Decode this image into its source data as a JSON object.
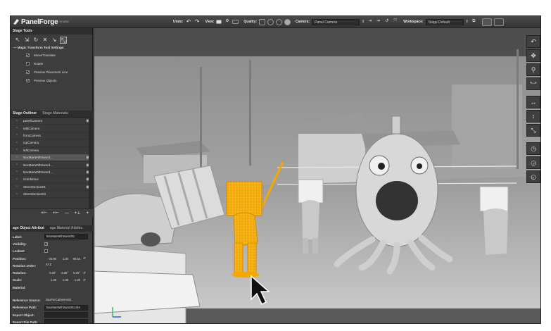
{
  "app": {
    "name": "PanelForge",
    "sup": "STUDIO"
  },
  "toolbar": {
    "undo_label": "Undo:",
    "undo_icon": "↶",
    "redo_icon": "↷",
    "view_label": "View:",
    "quality_label": "Quality:",
    "camera_label": "Camera:",
    "camera_value": "Panel Camera",
    "camera_spin": "⇕",
    "workspace_label": "Workspace:",
    "workspace_value": "Stage Default",
    "workspace_spin": "⇕"
  },
  "stage_tools": {
    "title": "Stage Tools",
    "magic_title": "Magic Transform Tool Settings:",
    "options": [
      {
        "label": "Move/Translate",
        "checked": true
      },
      {
        "label": "Rotate",
        "checked": false
      },
      {
        "label": "Preview Placement Line",
        "checked": true
      },
      {
        "label": "Preview Objects",
        "checked": true
      }
    ]
  },
  "outliner": {
    "tab_active": "Stage Outliner",
    "tab_inactive": "Stage Materials",
    "items": [
      {
        "name": "panelCamera",
        "highlight": false,
        "vis": "◉"
      },
      {
        "name": "editCamera",
        "highlight": false,
        "vis": ""
      },
      {
        "name": "frontCamera",
        "highlight": false,
        "vis": ""
      },
      {
        "name": "topCamera",
        "highlight": false,
        "vis": ""
      },
      {
        "name": "leftCamera",
        "highlight": false,
        "vis": ""
      },
      {
        "name": "BoxManWithSword...",
        "highlight": true,
        "vis": "◉"
      },
      {
        "name": "BoxManWithSword...",
        "highlight": false,
        "vis": "◉"
      },
      {
        "name": "BoxManWithSword...",
        "highlight": false,
        "vis": "◉"
      },
      {
        "name": "Grimbletus",
        "highlight": false,
        "vis": "◉"
      },
      {
        "name": "StreetSection01",
        "highlight": false,
        "vis": "◉"
      },
      {
        "name": "StreetSection03",
        "highlight": false,
        "vis": ""
      }
    ],
    "buttons": [
      "+⊢",
      "+⊢",
      "—",
      "+⊥",
      "+"
    ]
  },
  "attributes": {
    "tab_active": "age Object Attribut",
    "tab_inactive": "age Material Attribu",
    "label_label": "Label:",
    "label_value": "BoxManWithSword01",
    "visibility_label": "Visibility:",
    "locked_label": "Locked:",
    "position_label": "Position:",
    "position": [
      "-46.90",
      "1.20",
      "90.54"
    ],
    "rotation_order_label": "Rotation Order:",
    "rotation_order": "XYZ",
    "rotation_label": "Rotation:",
    "rotation": [
      "0.00°",
      "-3.66°",
      "0.00°"
    ],
    "scale_label": "Scale:",
    "scale": [
      "1.38",
      "1.38",
      "1.38"
    ],
    "material_label": "Material:",
    "ref_source_label": "Reference Source:",
    "ref_source": "DaxForCatherine01",
    "ref_path_label": "Reference Path:",
    "ref_path": "BoxManWithSword01.sks",
    "export_object_label": "Export Object:",
    "export_path_label": "Export File Path:"
  },
  "colors": {
    "selection": "#f5a800",
    "ui_dark": "#3b3b3b"
  }
}
